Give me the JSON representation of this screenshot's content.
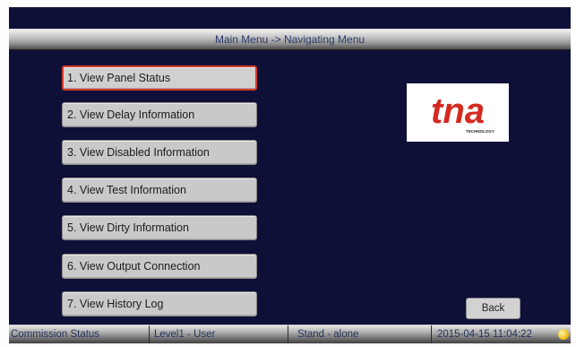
{
  "header": {
    "title": "Main Menu -> Navigating Menu"
  },
  "menu": {
    "items": [
      {
        "label": "1. View Panel Status"
      },
      {
        "label": "2. View Delay Information"
      },
      {
        "label": "3. View Disabled Information"
      },
      {
        "label": "4. View Test Information"
      },
      {
        "label": "5. View Dirty Information"
      },
      {
        "label": "6. View Output Connection"
      },
      {
        "label": "7. View History Log"
      }
    ],
    "selected_index": 0
  },
  "logo": {
    "text": "tna",
    "subtext": "TECHNOLOGY",
    "color": "#d42a20"
  },
  "buttons": {
    "back_label": "Back"
  },
  "status_bar": {
    "commission": "Commission Status",
    "level": "Level1 - User",
    "mode": "Stand - alone",
    "datetime": "2015-04-15 11:04:22",
    "indicator_icon": "status-light-icon"
  },
  "colors": {
    "background": "#0f1038",
    "selected_border": "#d83a2a",
    "button_face": "#c9c9c9"
  }
}
